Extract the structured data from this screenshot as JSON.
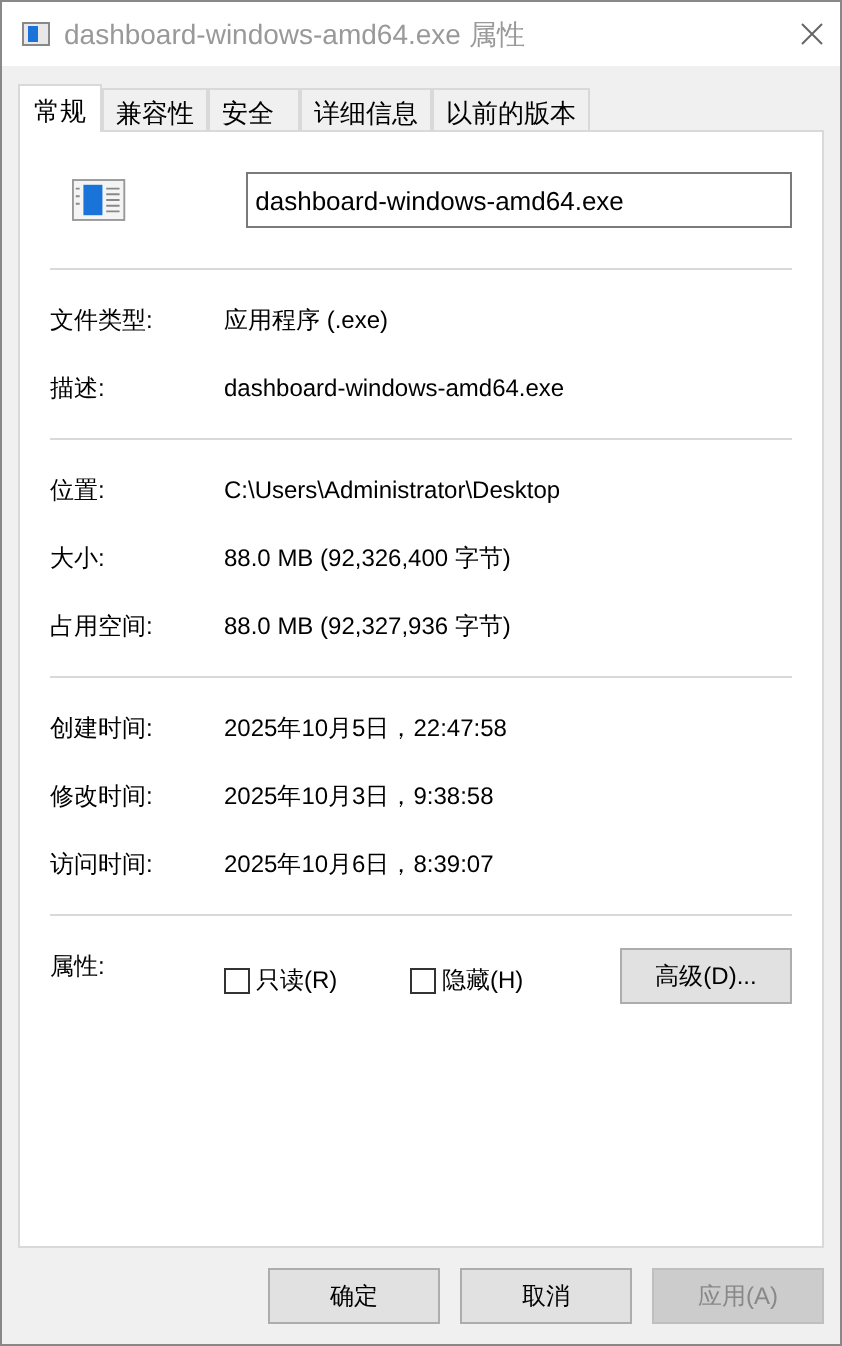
{
  "window": {
    "title": "dashboard-windows-amd64.exe 属性"
  },
  "tabs": [
    {
      "label": "常规",
      "selected": true
    },
    {
      "label": "兼容性",
      "selected": false
    },
    {
      "label": "安全",
      "selected": false
    },
    {
      "label": "详细信息",
      "selected": false
    },
    {
      "label": "以前的版本",
      "selected": false
    }
  ],
  "file_name": {
    "value": "dashboard-windows-amd64.exe"
  },
  "sections": [
    [
      {
        "label": "文件类型:",
        "value": "应用程序 (.exe)"
      },
      {
        "label": "描述:",
        "value": "dashboard-windows-amd64.exe"
      }
    ],
    [
      {
        "label": "位置:",
        "value": "C:\\Users\\Administrator\\Desktop"
      },
      {
        "label": "大小:",
        "value": "88.0 MB (92,326,400 字节)"
      },
      {
        "label": "占用空间:",
        "value": "88.0 MB (92,327,936 字节)"
      }
    ],
    [
      {
        "label": "创建时间:",
        "value": "2025年10月5日，22:47:58"
      },
      {
        "label": "修改时间:",
        "value": "2025年10月3日，9:38:58"
      },
      {
        "label": "访问时间:",
        "value": "2025年10月6日，8:39:07"
      }
    ]
  ],
  "attributes": {
    "label": "属性:",
    "checkboxes": [
      {
        "label": "只读(R)",
        "checked": false
      },
      {
        "label": "隐藏(H)",
        "checked": false
      }
    ],
    "advanced_button": "高级(D)..."
  },
  "buttons": [
    {
      "label": "确定",
      "disabled": false
    },
    {
      "label": "取消",
      "disabled": false
    },
    {
      "label": "应用(A)",
      "disabled": true
    }
  ]
}
